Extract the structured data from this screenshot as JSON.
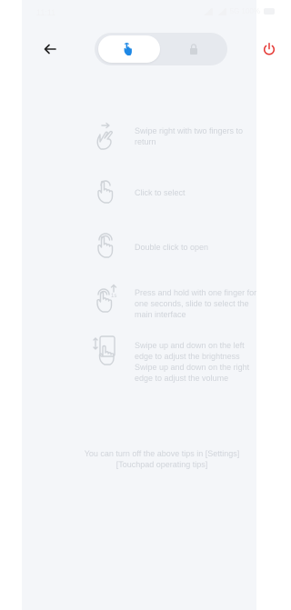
{
  "status_bar": {
    "time": "11:11",
    "right_text": "5G 100%"
  },
  "header": {
    "back_icon": "back-arrow-icon",
    "segments": [
      {
        "icon": "touch-hand-icon",
        "active": true,
        "color": "#1e88e5"
      },
      {
        "icon": "lock-icon",
        "active": false,
        "color": "#cfd3d8"
      }
    ],
    "power_icon": "power-icon",
    "power_color": "#e53935"
  },
  "tips": [
    {
      "icon": "swipe-right-two-fingers-icon",
      "text": "Swipe right with two fingers to return"
    },
    {
      "icon": "tap-icon",
      "text": "Click to select"
    },
    {
      "icon": "double-tap-icon",
      "text": "Double click to open"
    },
    {
      "icon": "press-hold-icon",
      "text": "Press and hold with one finger for one seconds, slide to select the main interface"
    },
    {
      "icon": "swipe-up-down-edge-icon",
      "text": "Swipe up and down on the left edge to adjust the brightness Swipe up and down on the right edge to adjust the volume"
    }
  ],
  "footer_note": "You can turn off the above tips in [Settings] [Touchpad operating tips]"
}
